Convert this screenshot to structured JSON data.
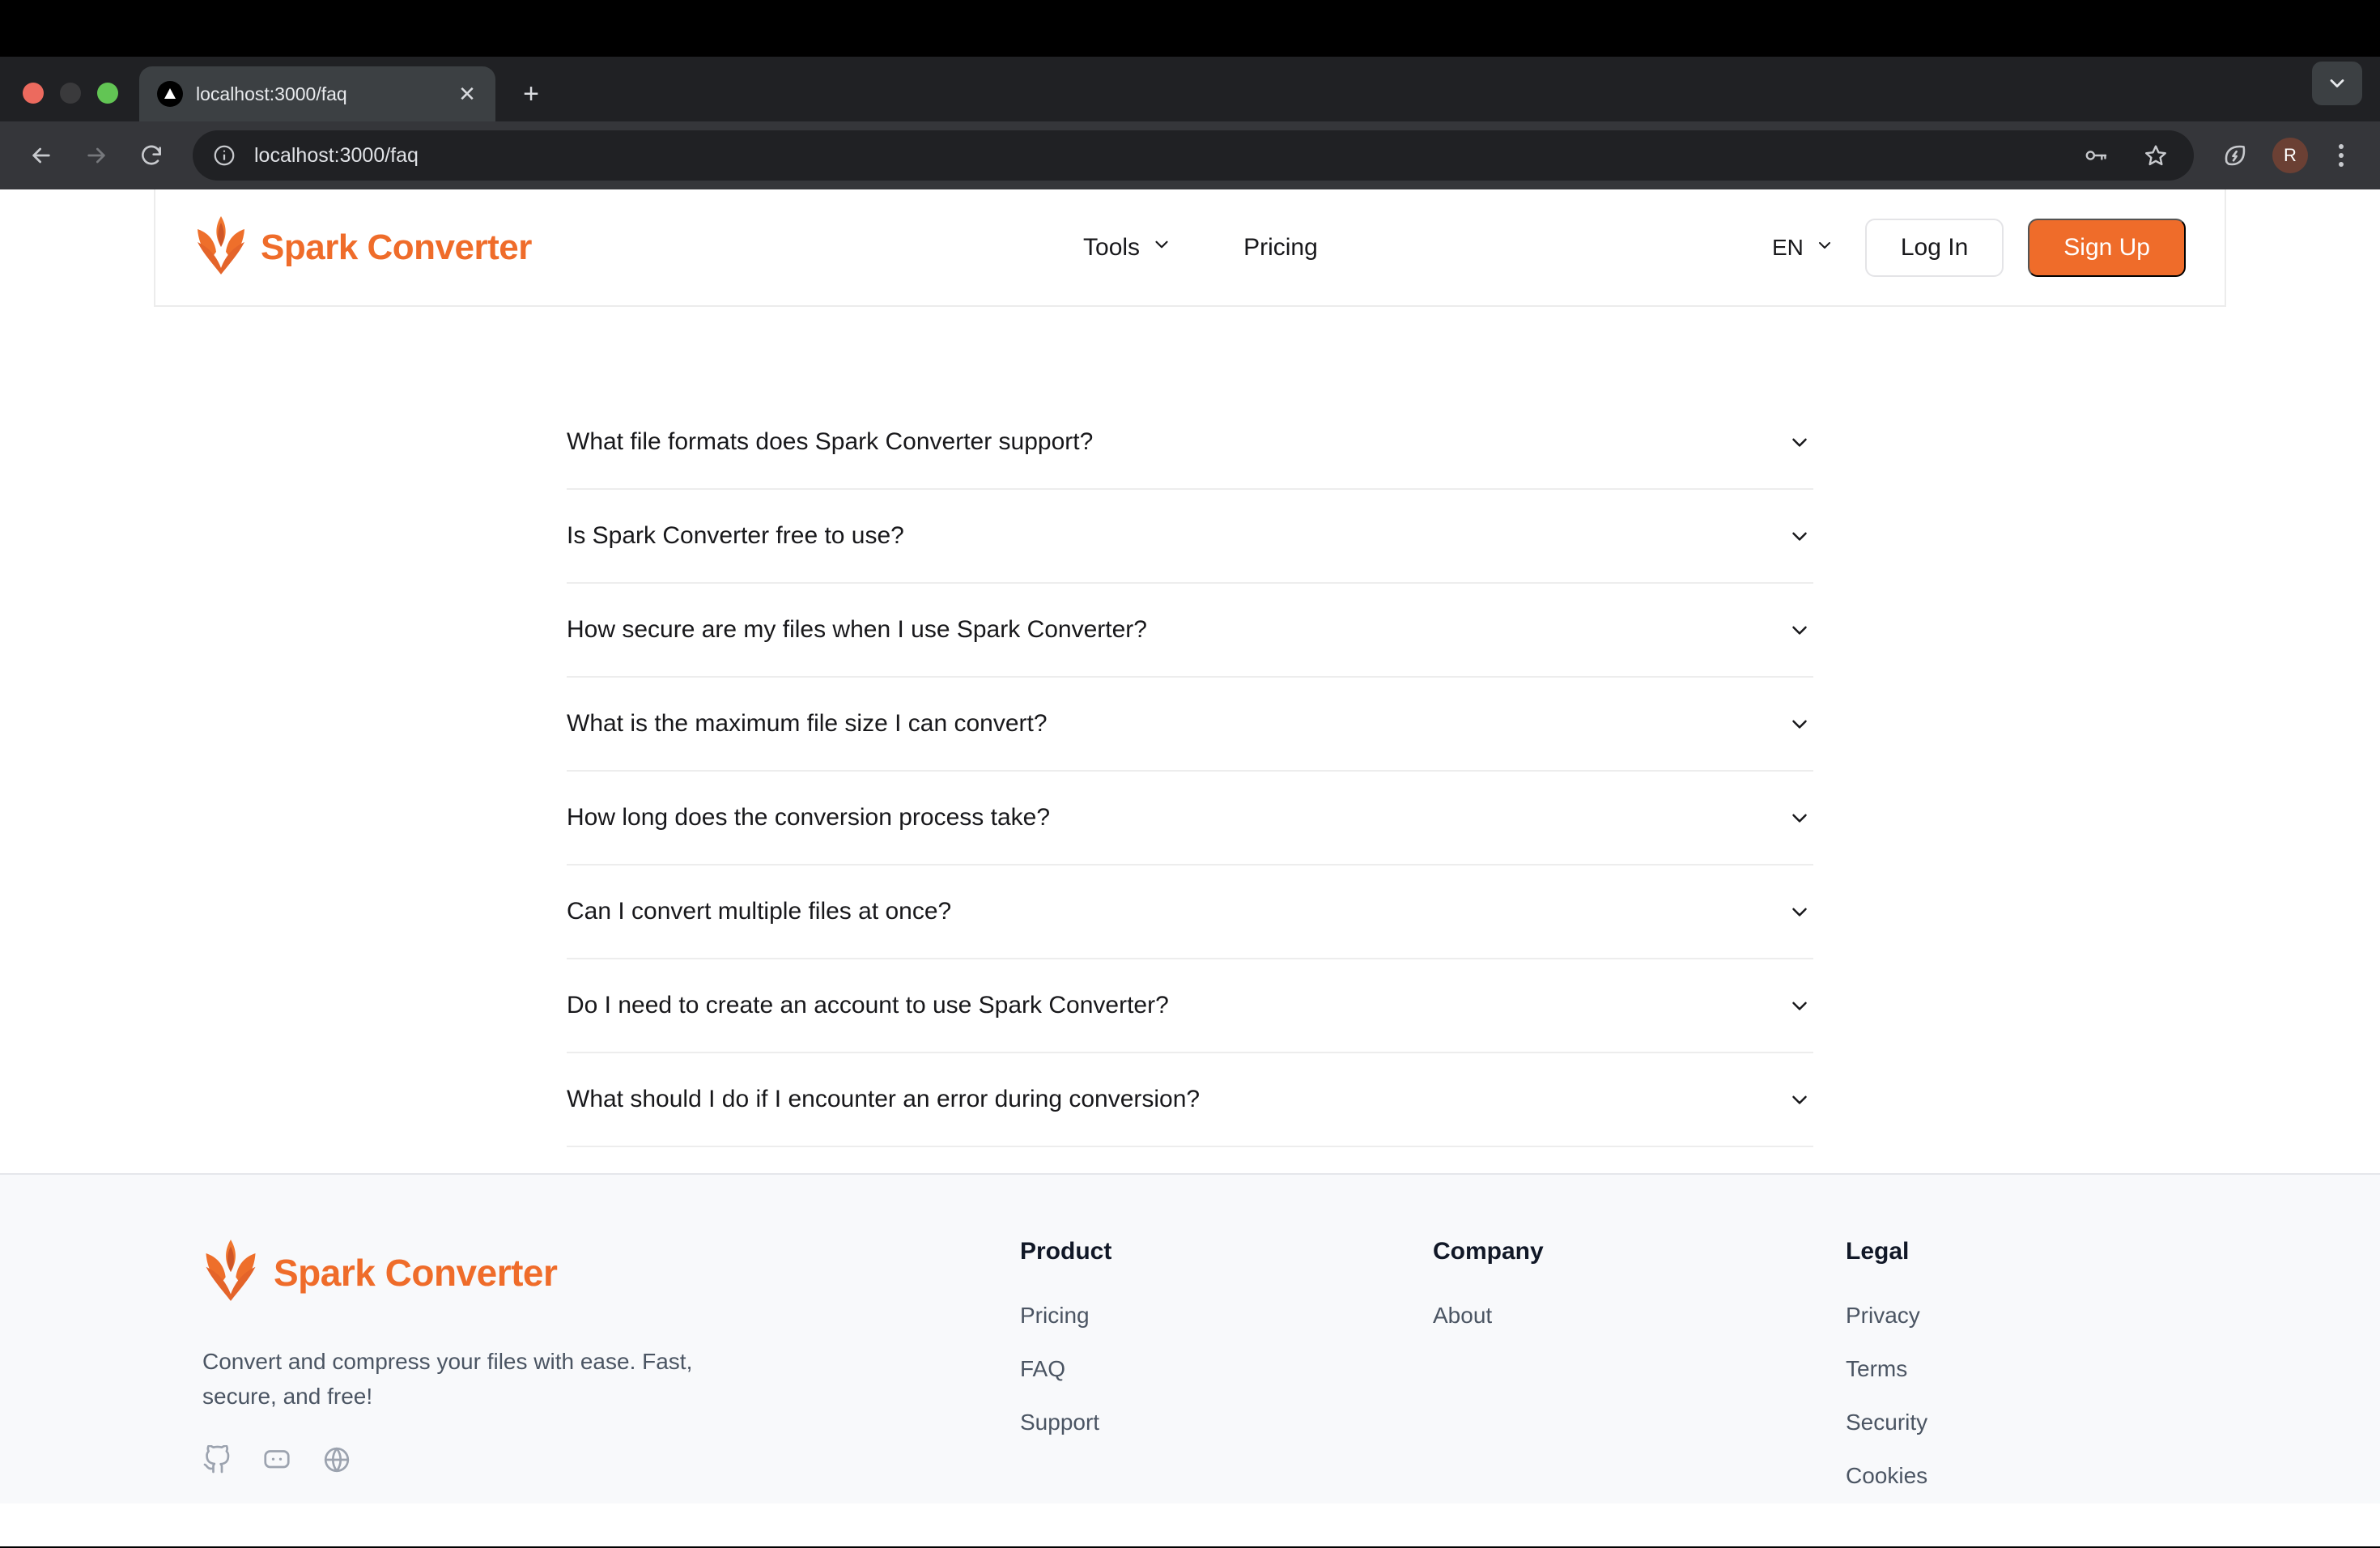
{
  "browser": {
    "tab": {
      "title": "localhost:3000/faq",
      "favicon_icon": "spark-triangle-icon",
      "close_icon": "close-icon"
    },
    "new_tab_label": "+",
    "tab_list_icon": "chevron-down-icon",
    "nav": {
      "back_icon": "back-arrow-icon",
      "forward_icon": "forward-arrow-icon",
      "reload_icon": "reload-icon"
    },
    "omnibox": {
      "info_icon": "info-circle-icon",
      "url_scheme_host": "localhost:3000",
      "url_path": "/faq",
      "full_url": "localhost:3000/faq",
      "key_icon": "password-key-icon",
      "star_icon": "bookmark-star-icon"
    },
    "actions": {
      "leaf_icon": "energy-saver-leaf-icon",
      "profile_initial": "R",
      "menu_icon": "kebab-menu-icon"
    }
  },
  "site": {
    "brand": {
      "name": "Spark Converter",
      "logo_icon": "spark-flame-logo-icon",
      "color": "#ef6c2a"
    },
    "nav": {
      "tools": {
        "label": "Tools",
        "chevron_icon": "chevron-down-icon"
      },
      "pricing": {
        "label": "Pricing"
      },
      "language": {
        "value": "EN",
        "chevron_icon": "chevron-down-icon"
      },
      "login": {
        "label": "Log In"
      },
      "signup": {
        "label": "Sign Up"
      }
    }
  },
  "faq": {
    "items": [
      {
        "question": "What file formats does Spark Converter support?",
        "chevron_icon": "chevron-down-icon"
      },
      {
        "question": "Is Spark Converter free to use?",
        "chevron_icon": "chevron-down-icon"
      },
      {
        "question": "How secure are my files when I use Spark Converter?",
        "chevron_icon": "chevron-down-icon"
      },
      {
        "question": "What is the maximum file size I can convert?",
        "chevron_icon": "chevron-down-icon"
      },
      {
        "question": "How long does the conversion process take?",
        "chevron_icon": "chevron-down-icon"
      },
      {
        "question": "Can I convert multiple files at once?",
        "chevron_icon": "chevron-down-icon"
      },
      {
        "question": "Do I need to create an account to use Spark Converter?",
        "chevron_icon": "chevron-down-icon"
      },
      {
        "question": "What should I do if I encounter an error during conversion?",
        "chevron_icon": "chevron-down-icon"
      }
    ]
  },
  "footer": {
    "brand": {
      "name": "Spark Converter",
      "logo_icon": "spark-flame-logo-icon"
    },
    "tagline": "Convert and compress your files with ease. Fast, secure, and free!",
    "social": [
      {
        "icon": "github-icon"
      },
      {
        "icon": "chat-bubble-icon"
      },
      {
        "icon": "globe-icon"
      }
    ],
    "columns": [
      {
        "heading": "Product",
        "links": [
          "Pricing",
          "FAQ",
          "Support"
        ]
      },
      {
        "heading": "Company",
        "links": [
          "About"
        ]
      },
      {
        "heading": "Legal",
        "links": [
          "Privacy",
          "Terms",
          "Security",
          "Cookies"
        ]
      }
    ]
  }
}
